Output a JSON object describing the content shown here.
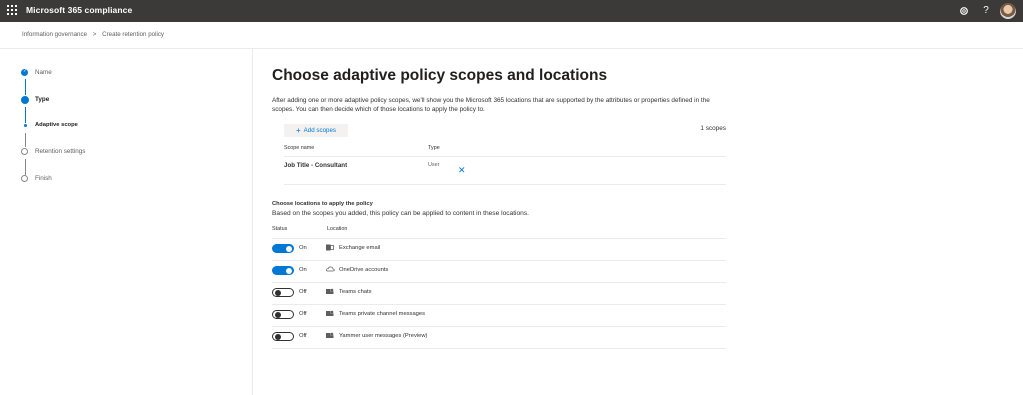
{
  "header": {
    "app_title": "Microsoft 365 compliance",
    "icons": [
      "waffle-icon",
      "settings-icon",
      "help-icon",
      "avatar"
    ],
    "help_glyph": "?"
  },
  "breadcrumb": {
    "items": [
      "Information governance",
      "Create retention policy"
    ],
    "separator": ">"
  },
  "wizard": {
    "steps": [
      {
        "label": "Name",
        "state": "completed"
      },
      {
        "label": "Type",
        "state": "current"
      },
      {
        "label": "Adaptive scope",
        "state": "current-substep"
      },
      {
        "label": "Retention settings",
        "state": "upcoming"
      },
      {
        "label": "Finish",
        "state": "upcoming"
      }
    ]
  },
  "main": {
    "title": "Choose adaptive policy scopes and locations",
    "description": "After adding one or more adaptive policy scopes, we'll show you the Microsoft 365 locations that are supported by the attributes or properties defined in the scopes. You can then decide which of those locations to apply the policy to.",
    "add_scopes_label": "Add scopes",
    "scope_count": "1 scopes",
    "scopes_table": {
      "columns": [
        "Scope name",
        "Type"
      ],
      "rows": [
        {
          "name": "Job Title - Consultant",
          "type": "User"
        }
      ]
    },
    "locations": {
      "title": "Choose locations to apply the policy",
      "description": "Based on the scopes you added, this policy can be applied to content in these locations.",
      "columns": [
        "Status",
        "Location"
      ],
      "rows": [
        {
          "status": "On",
          "enabled": true,
          "icon": "exchange-icon",
          "name": "Exchange email"
        },
        {
          "status": "On",
          "enabled": true,
          "icon": "onedrive-icon",
          "name": "OneDrive accounts"
        },
        {
          "status": "Off",
          "enabled": false,
          "icon": "teams-icon",
          "name": "Teams chats"
        },
        {
          "status": "Off",
          "enabled": false,
          "icon": "teams-icon",
          "name": "Teams private channel messages"
        },
        {
          "status": "Off",
          "enabled": false,
          "icon": "yammer-icon",
          "name": "Yammer user messages (Preview)"
        }
      ]
    }
  },
  "colors": {
    "topbar": "#3b3a39",
    "accent": "#0078d4",
    "text": "#323130"
  }
}
